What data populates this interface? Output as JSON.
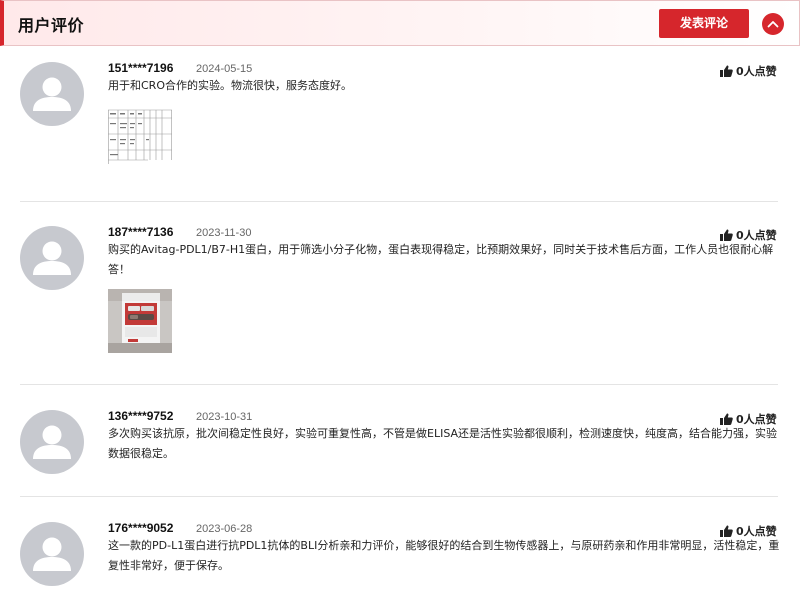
{
  "header": {
    "title": "用户评价",
    "post_button": "发表评论"
  },
  "reviews": [
    {
      "user": "151****7196",
      "date": "2024-05-15",
      "likes": "0人点赞",
      "content": "用于和CRO合作的实验。物流很快，服务态度好。",
      "image": "table-document-thumbnail"
    },
    {
      "user": "187****7136",
      "date": "2023-11-30",
      "likes": "0人点赞",
      "content": "购买的Avitag-PDL1/B7-H1蛋白，用于筛选小分子化物，蛋白表现得稳定，比预期效果好，同时关于技术售后方面，工作人员也很耐心解答！",
      "image": "product-box-thumbnail"
    },
    {
      "user": "136****9752",
      "date": "2023-10-31",
      "likes": "0人点赞",
      "content": "多次购买该抗原，批次间稳定性良好，实验可重复性高，不管是做ELISA还是活性实验都很顺利，检测速度快，纯度高，结合能力强，实验数据很稳定。"
    },
    {
      "user": "176****9052",
      "date": "2023-06-28",
      "likes": "0人点赞",
      "content": "这一款的PD-L1蛋白进行抗PDL1抗体的BLI分析亲和力评价，能够很好的结合到生物传感器上，与原研药亲和作用非常明显，活性稳定，重复性非常好，便于保存。"
    }
  ],
  "colors": {
    "accent": "#d6262c",
    "avatar": "#c7c9cf",
    "divider": "#e4e4e4"
  }
}
